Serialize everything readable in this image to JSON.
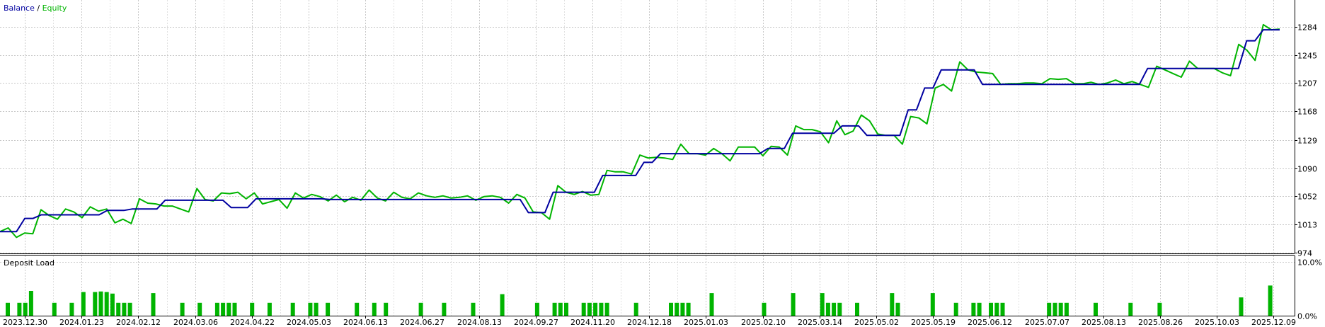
{
  "chart_data": [
    {
      "type": "line",
      "legend": {
        "placement": "top-left",
        "separator": " / "
      },
      "series": [
        {
          "name": "Balance",
          "color": "#0000a0",
          "values": [
            1003,
            1003,
            1003,
            1021,
            1021,
            1026,
            1026,
            1026,
            1026,
            1026,
            1026,
            1026,
            1026,
            1032,
            1032,
            1032,
            1034,
            1034,
            1034,
            1034,
            1046,
            1046,
            1046,
            1046,
            1046,
            1046,
            1046,
            1046,
            1036,
            1036,
            1036,
            1048,
            1048,
            1048,
            1048,
            1048,
            1048,
            1048,
            1048,
            1048,
            1047,
            1047,
            1047,
            1047,
            1047,
            1047,
            1047,
            1047,
            1047,
            1047,
            1047,
            1047,
            1047,
            1047,
            1047,
            1047,
            1047,
            1047,
            1047,
            1047,
            1047,
            1047,
            1047,
            1047,
            1029,
            1029,
            1029,
            1057,
            1057,
            1057,
            1057,
            1057,
            1057,
            1080,
            1080,
            1080,
            1080,
            1080,
            1098,
            1098,
            1110,
            1110,
            1110,
            1110,
            1110,
            1110,
            1110,
            1110,
            1110,
            1110,
            1110,
            1110,
            1110,
            1117,
            1117,
            1117,
            1138,
            1138,
            1138,
            1138,
            1138,
            1138,
            1148,
            1148,
            1148,
            1135,
            1135,
            1135,
            1135,
            1135,
            1170,
            1170,
            1200,
            1200,
            1225,
            1225,
            1225,
            1225,
            1225,
            1205,
            1205,
            1205,
            1205,
            1205,
            1205,
            1205,
            1205,
            1205,
            1205,
            1205,
            1205,
            1205,
            1205,
            1205,
            1205,
            1205,
            1205,
            1205,
            1205,
            1227,
            1227,
            1227,
            1227,
            1227,
            1227,
            1227,
            1227,
            1227,
            1227,
            1227,
            1227,
            1265,
            1265,
            1280,
            1280,
            1280
          ]
        },
        {
          "name": "Equity",
          "color": "#00b400",
          "values": [
            1003,
            1008,
            995,
            1001,
            1000,
            1033,
            1025,
            1020,
            1034,
            1030,
            1022,
            1037,
            1031,
            1034,
            1015,
            1020,
            1014,
            1048,
            1042,
            1041,
            1038,
            1038,
            1034,
            1030,
            1062,
            1047,
            1045,
            1056,
            1055,
            1057,
            1048,
            1056,
            1041,
            1044,
            1047,
            1035,
            1056,
            1049,
            1054,
            1051,
            1045,
            1053,
            1044,
            1050,
            1046,
            1060,
            1049,
            1045,
            1057,
            1050,
            1048,
            1056,
            1052,
            1050,
            1052,
            1049,
            1050,
            1052,
            1046,
            1051,
            1052,
            1050,
            1042,
            1054,
            1049,
            1030,
            1029,
            1020,
            1066,
            1057,
            1054,
            1058,
            1053,
            1054,
            1087,
            1085,
            1085,
            1082,
            1108,
            1104,
            1105,
            1104,
            1102,
            1123,
            1110,
            1110,
            1108,
            1117,
            1110,
            1100,
            1119,
            1119,
            1119,
            1107,
            1120,
            1119,
            1108,
            1148,
            1143,
            1143,
            1140,
            1125,
            1155,
            1136,
            1141,
            1163,
            1155,
            1137,
            1135,
            1135,
            1123,
            1161,
            1159,
            1151,
            1200,
            1205,
            1196,
            1236,
            1225,
            1222,
            1221,
            1220,
            1205,
            1206,
            1206,
            1207,
            1207,
            1206,
            1213,
            1212,
            1213,
            1206,
            1206,
            1208,
            1205,
            1207,
            1211,
            1206,
            1209,
            1205,
            1201,
            1230,
            1225,
            1220,
            1215,
            1237,
            1227,
            1227,
            1227,
            1221,
            1217,
            1260,
            1252,
            1238,
            1287,
            1280,
            1281
          ]
        }
      ],
      "x_labels": [
        "2023.12.30",
        "2024.01.23",
        "2024.02.12",
        "2024.03.06",
        "2024.04.22",
        "2024.05.03",
        "2024.06.13",
        "2024.06.27",
        "2024.08.13",
        "2024.09.27",
        "2024.11.20",
        "2024.12.18",
        "2025.01.03",
        "2025.02.10",
        "2025.03.14",
        "2025.05.02",
        "2025.05.19",
        "2025.06.12",
        "2025.07.07",
        "2025.08.13",
        "2025.08.26",
        "2025.10.03",
        "2025.12.09"
      ],
      "y_ticks": [
        "974",
        "1013",
        "1052",
        "1090",
        "1129",
        "1168",
        "1207",
        "1245",
        "1284"
      ],
      "ylim": [
        974,
        1300
      ],
      "grid": true
    },
    {
      "type": "bar",
      "title": "Deposit Load",
      "color": "#00b400",
      "y_ticks": [
        "0.0%",
        "10.0%"
      ],
      "ylim": [
        0,
        10
      ],
      "values": [
        2.4,
        0,
        2.4,
        2.4,
        4.6,
        0,
        0,
        0,
        2.4,
        0,
        0,
        2.4,
        0,
        4.4,
        0,
        4.4,
        4.5,
        4.4,
        4.1,
        2.4,
        2.4,
        2.4,
        0,
        0,
        0,
        4.2,
        0,
        0,
        0,
        0,
        2.4,
        0,
        0,
        2.4,
        0,
        0,
        2.4,
        2.4,
        2.4,
        2.4,
        0,
        0,
        2.4,
        0,
        0,
        2.4,
        0,
        0,
        0,
        2.4,
        0,
        0,
        2.4,
        2.4,
        0,
        2.4,
        0,
        0,
        0,
        0,
        2.4,
        0,
        0,
        2.4,
        0,
        2.4,
        0,
        0,
        0,
        0,
        0,
        2.4,
        0,
        0,
        0,
        2.4,
        0,
        0,
        0,
        0,
        2.4,
        0,
        0,
        0,
        0,
        4.0,
        0,
        0,
        0,
        0,
        0,
        2.4,
        0,
        0,
        2.4,
        2.4,
        2.4,
        0,
        0,
        2.4,
        2.4,
        2.4,
        2.4,
        2.4,
        0,
        0,
        0,
        0,
        2.4,
        0,
        0,
        0,
        0,
        0,
        2.4,
        2.4,
        2.4,
        2.4,
        0,
        0,
        0,
        4.2,
        0,
        0,
        0,
        0,
        0,
        0,
        0,
        0,
        2.4,
        0,
        0,
        0,
        0,
        4.2,
        0,
        0,
        0,
        0,
        4.2,
        2.4,
        2.4,
        2.4,
        0,
        0,
        2.4,
        0,
        0,
        0,
        0,
        0,
        4.2,
        2.4,
        0,
        0,
        0,
        0,
        0,
        4.2,
        0,
        0,
        0,
        2.4,
        0,
        0,
        2.4,
        2.4,
        0,
        2.4,
        2.4,
        2.4,
        0,
        0,
        0,
        0,
        0,
        0,
        0,
        2.4,
        2.4,
        2.4,
        2.4,
        0,
        0,
        0,
        0,
        2.4,
        0,
        0,
        0,
        0,
        0,
        2.4,
        0,
        0,
        0,
        0,
        2.4,
        0,
        0,
        0,
        0,
        0,
        0,
        0,
        0,
        0,
        0,
        0,
        0,
        0,
        3.4,
        0,
        0,
        0,
        0,
        5.6,
        0
      ]
    }
  ]
}
